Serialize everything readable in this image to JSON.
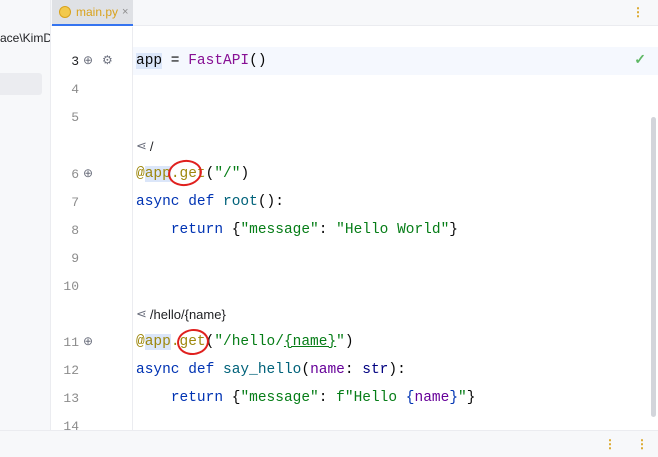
{
  "project": {
    "path_fragment": "ace\\KimDc"
  },
  "tabs": [
    {
      "label": "main.py",
      "close": "×"
    }
  ],
  "tabbar": {
    "more": "⋮"
  },
  "gutter": {
    "line_numbers": [
      "3",
      "4",
      "5",
      "6",
      "7",
      "8",
      "9",
      "10",
      "11",
      "12",
      "13",
      "14"
    ]
  },
  "code": {
    "line3": {
      "ident": "app",
      "op": " = ",
      "cls": "FastAPI",
      "rest": "()"
    },
    "hint1": "/",
    "line6": {
      "at": "@",
      "obj": "app",
      "dot": ".",
      "meth": "get",
      "open": "(",
      "str": "\"/\"",
      "close": ")"
    },
    "line7": {
      "kw1": "async",
      "kw2": "def",
      "fn": "root",
      "rest": "():"
    },
    "line8": {
      "kw": "return",
      "open": "{",
      "key": "\"message\"",
      "colon": ": ",
      "val": "\"Hello World\"",
      "close": "}"
    },
    "hint2": "/hello/{name}",
    "line11": {
      "at": "@",
      "obj": "app",
      "dot": ".",
      "meth": "get",
      "open": "(",
      "str_a": "\"/hello/",
      "str_b": "{name}",
      "str_c": "\"",
      "close": ")"
    },
    "line12": {
      "kw1": "async",
      "kw2": "def",
      "fn": "say_hello",
      "p_open": "(",
      "param": "name",
      "colon": ": ",
      "type": "str",
      "p_close": "):"
    },
    "line13": {
      "kw": "return",
      "open": "{",
      "key": "\"message\"",
      "colon": ": ",
      "fpre": "f\"Hello ",
      "ib_open": "{",
      "ivar": "name",
      "ib_close": "}",
      "fend": "\"",
      "close": "}"
    }
  },
  "status": {
    "icon1": "⋮",
    "icon2": "⋮"
  },
  "colors": {
    "accent": "#3574f0",
    "annotation": "#e0201e",
    "check": "#5fb865"
  }
}
